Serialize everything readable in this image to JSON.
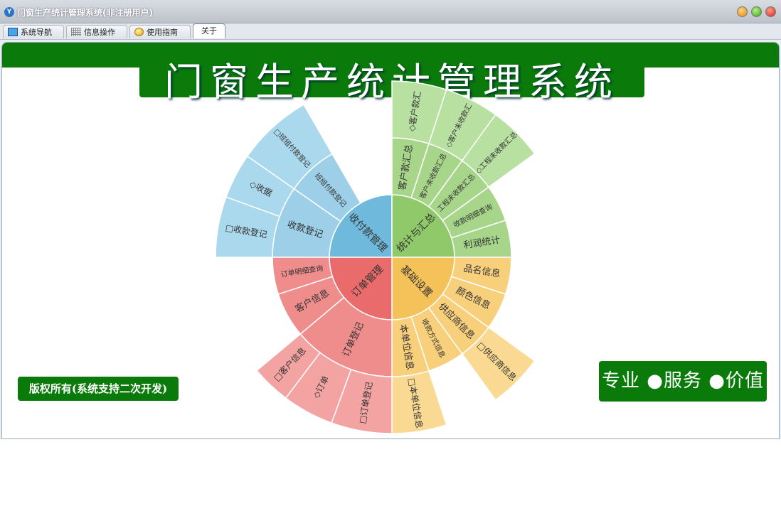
{
  "window": {
    "title": "门窗生产统计管理系统(非注册用户)"
  },
  "tabs": [
    {
      "label": "系统导航",
      "icon": "monitor-icon"
    },
    {
      "label": "信息操作",
      "icon": "grid-icon"
    },
    {
      "label": "使用指南",
      "icon": "help-icon"
    },
    {
      "label": "关于",
      "icon": ""
    }
  ],
  "active_tab": "关于",
  "banner": {
    "title": "门窗生产统计管理系统"
  },
  "footer": {
    "copyright": "版权所有(系统支持二次开发)",
    "slogan": "专业 ●服务 ●价值"
  },
  "colors": {
    "accent_green": "#0a7a0a",
    "blue": "#6fb9dd",
    "green": "#8fc96a",
    "yellow": "#f5c25a",
    "red": "#ea6b6b"
  },
  "menu": [
    {
      "label": "收付款管理",
      "color": "#6fb9dd",
      "children": [
        {
          "label": "收款登记",
          "children": [
            {
              "label": "□收款登记"
            },
            {
              "label": "◇收据"
            }
          ]
        },
        {
          "label": "班组付款登记",
          "children": [
            {
              "label": "□班组付款登记"
            }
          ]
        }
      ]
    },
    {
      "label": "统计与汇总",
      "color": "#8fc96a",
      "children": [
        {
          "label": "客户款汇总",
          "children": [
            {
              "label": "◇客户款汇"
            }
          ]
        },
        {
          "label": "客户未收款汇总",
          "children": [
            {
              "label": "◇客户未收款汇"
            }
          ]
        },
        {
          "label": "工程未收款汇总",
          "children": [
            {
              "label": "◇工程未收款汇总"
            }
          ]
        },
        {
          "label": "收款明细查询",
          "children": []
        },
        {
          "label": "利润统计",
          "children": []
        }
      ]
    },
    {
      "label": "基础设置",
      "color": "#f5c25a",
      "children": [
        {
          "label": "品名信息",
          "children": []
        },
        {
          "label": "颜色信息",
          "children": []
        },
        {
          "label": "供应商信息",
          "children": [
            {
              "label": "□供应商信息"
            }
          ]
        },
        {
          "label": "收款方式信息",
          "children": []
        },
        {
          "label": "本单位信息",
          "children": [
            {
              "label": "□本单位信息"
            }
          ]
        }
      ]
    },
    {
      "label": "订单管理",
      "color": "#ea6b6b",
      "children": [
        {
          "label": "订单登记",
          "children": [
            {
              "label": "□订单登记"
            },
            {
              "label": "◇订单"
            },
            {
              "label": "□客户信息"
            }
          ]
        },
        {
          "label": "客户信息",
          "children": []
        },
        {
          "label": "订单明细查询",
          "children": []
        }
      ]
    }
  ]
}
